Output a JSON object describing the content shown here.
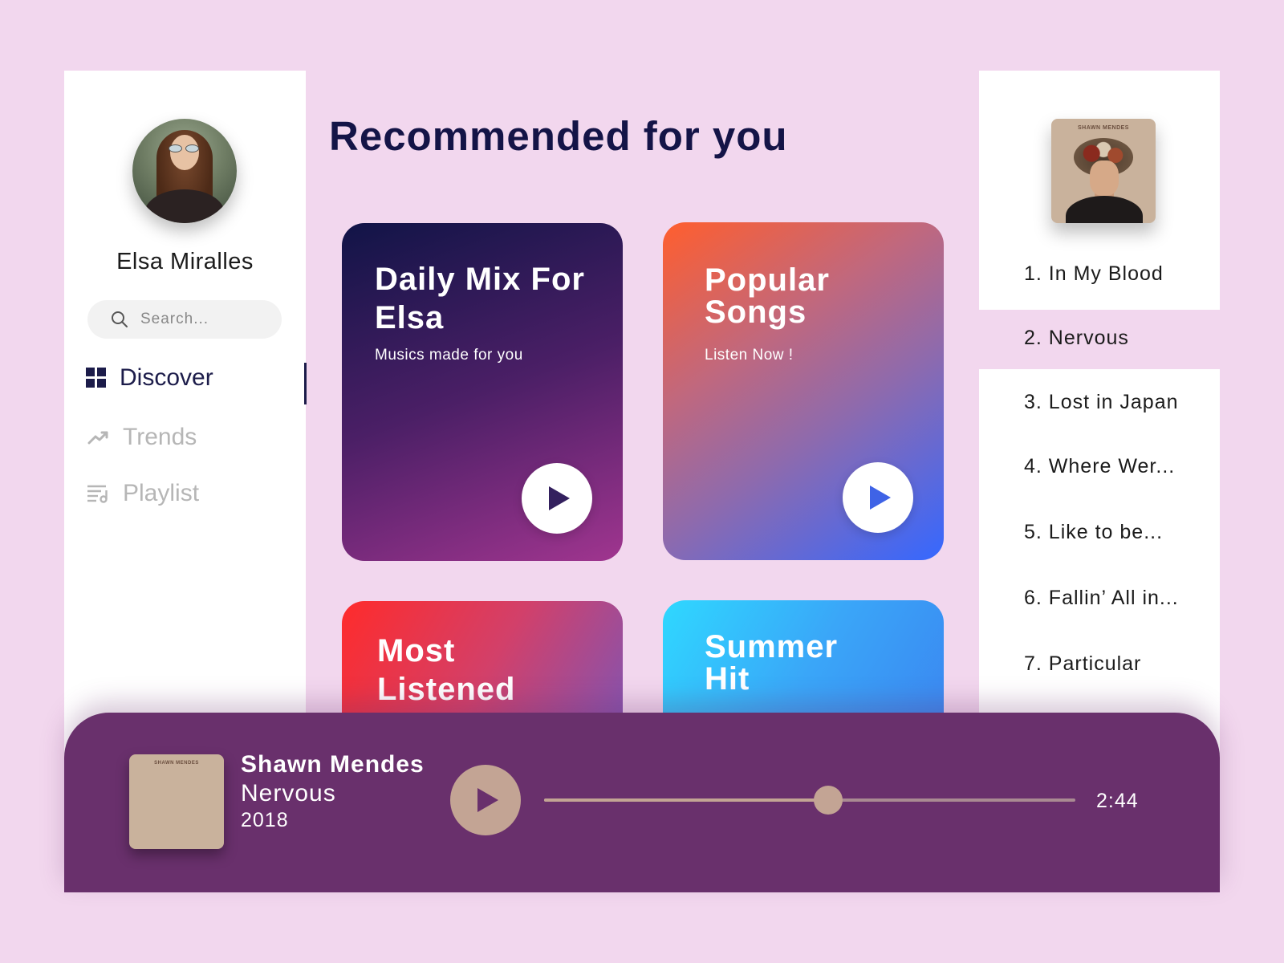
{
  "sidebar": {
    "user_name": "Elsa Miralles",
    "search_placeholder": "Search...",
    "nav": [
      {
        "label": "Discover",
        "icon": "grid-icon",
        "active": true
      },
      {
        "label": "Trends",
        "icon": "trend-up-icon",
        "active": false
      },
      {
        "label": "Playlist",
        "icon": "playlist-icon",
        "active": false
      }
    ]
  },
  "main": {
    "title": "Recommended for you",
    "cards": [
      {
        "title": "Daily Mix For Elsa",
        "subtitle": "Musics made for you"
      },
      {
        "title": "Popular Songs",
        "subtitle": "Listen Now !"
      },
      {
        "title": "Most Listened"
      },
      {
        "title": "Summer Hit"
      }
    ]
  },
  "queue": {
    "album_label": "SHAWN MENDES",
    "tracks": [
      "1. In My Blood",
      "2. Nervous",
      "3. Lost in Japan",
      "4. Where Wer...",
      "5. Like to be...",
      "6. Fallin’ All in...",
      "7. Particular"
    ],
    "selected_index": 1
  },
  "player": {
    "album_label": "SHAWN MENDES",
    "artist": "Shawn Mendes",
    "song": "Nervous",
    "year": "2018",
    "time": "2:44",
    "progress": 0.535
  },
  "colors": {
    "background": "#f2d7ee",
    "player": "#69306c",
    "accent": "#c3a494",
    "title": "#141447"
  }
}
